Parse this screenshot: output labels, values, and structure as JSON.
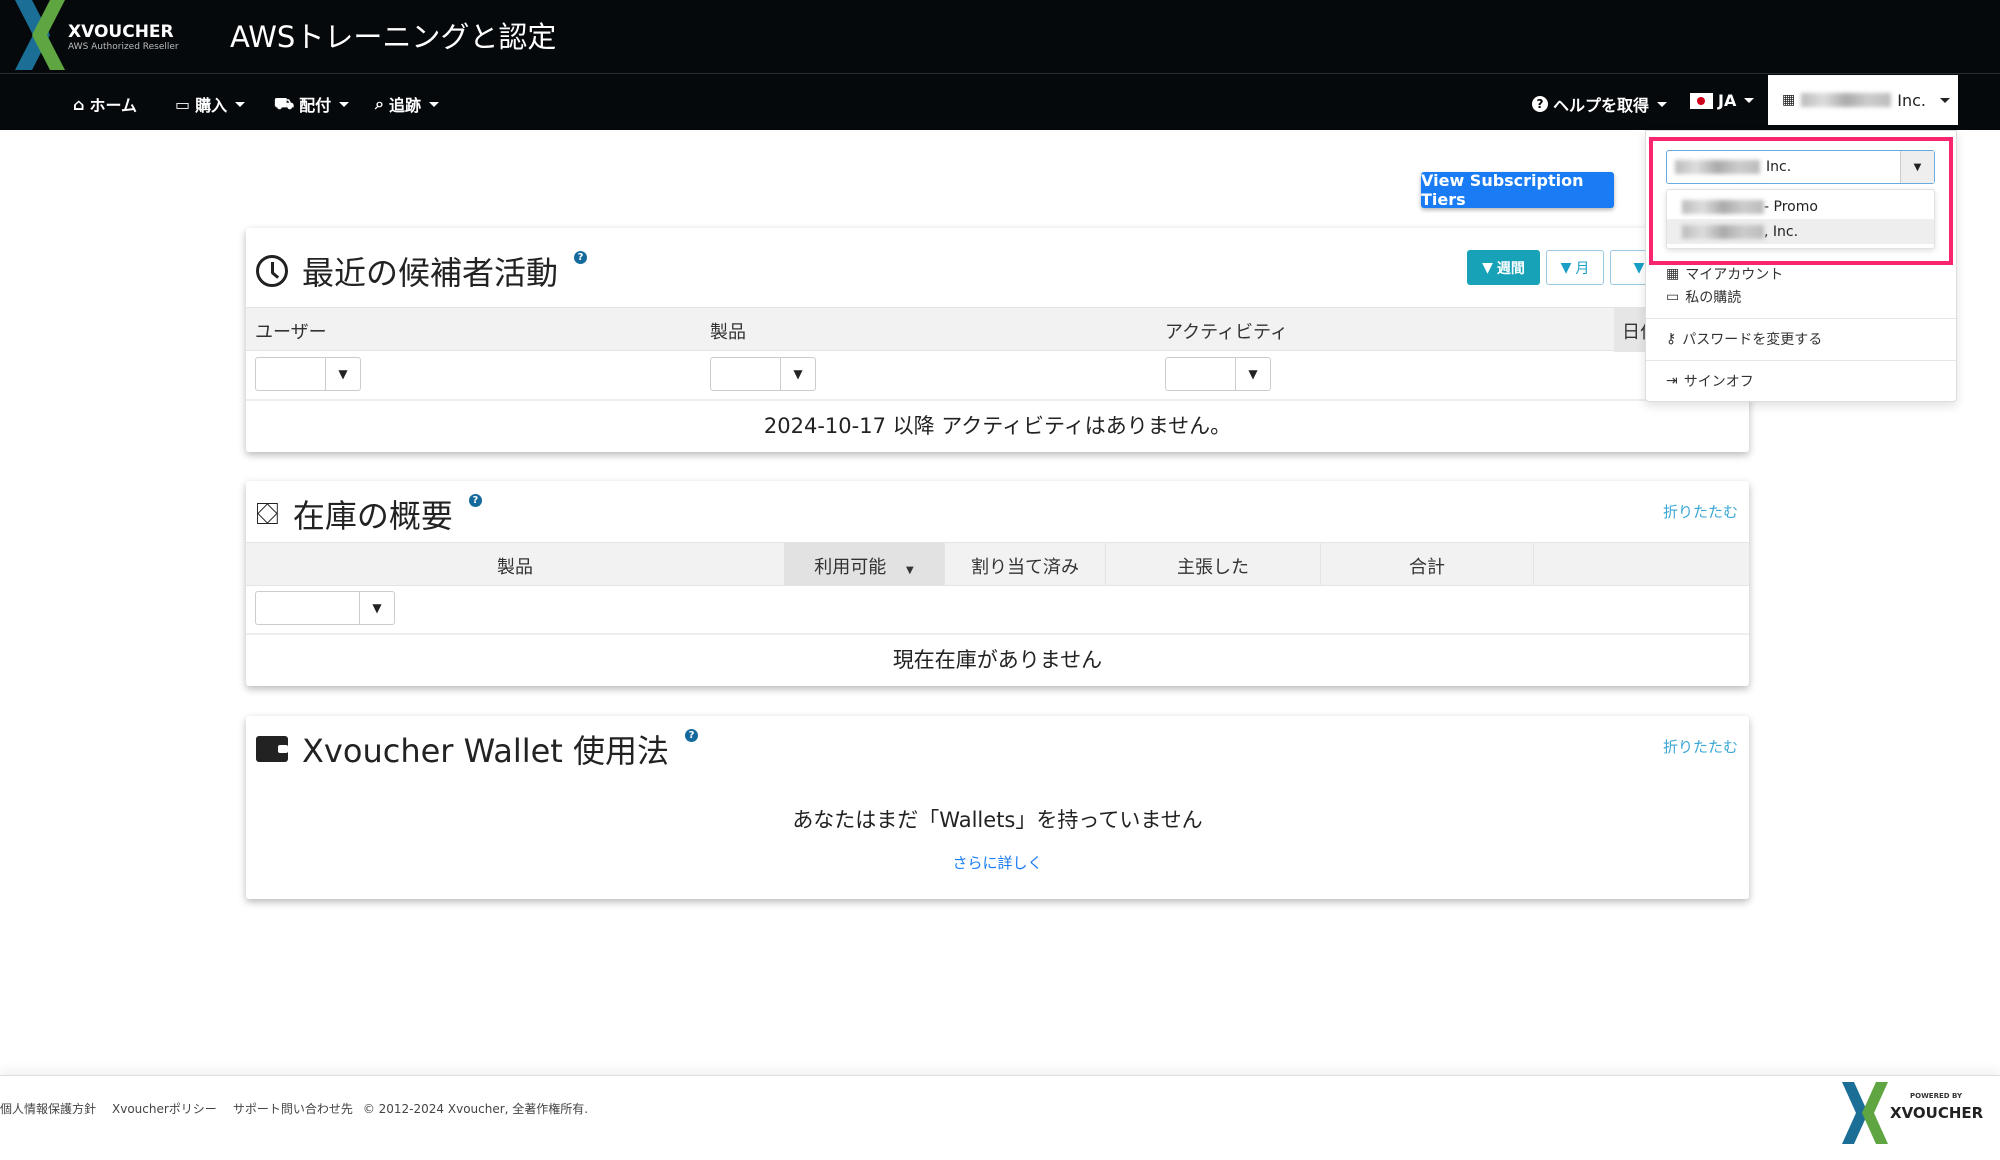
{
  "header": {
    "logo": {
      "brand": "XVOUCHER",
      "tagline": "AWS Authorized Reseller"
    },
    "title": "AWSトレーニングと認定"
  },
  "nav": {
    "items": [
      {
        "label": "ホーム",
        "icon": "home-icon"
      },
      {
        "label": "購入",
        "icon": "credit-card-icon"
      },
      {
        "label": "配付",
        "icon": "truck-icon"
      },
      {
        "label": "追跡",
        "icon": "search-icon"
      }
    ],
    "help": "ヘルプを取得",
    "language": "JA",
    "account_suffix": "Inc."
  },
  "account_menu": {
    "select_value_suffix": "Inc.",
    "options": [
      {
        "suffix": " - Promo",
        "selected": false
      },
      {
        "suffix": ", Inc.",
        "selected": true
      }
    ],
    "items": [
      "マイアカウント",
      "私の購読",
      "パスワードを変更する",
      "サインオフ"
    ],
    "highlight_color": "#f7266e"
  },
  "view_tiers_button": "View Subscription Tiers",
  "activity": {
    "title": "最近の候補者活動",
    "filters": [
      "週間",
      "月"
    ],
    "columns": [
      "ユーザー",
      "製品",
      "アクティビティ",
      "日付"
    ],
    "empty": "2024-10-17 以降 アクティビティはありません。"
  },
  "inventory": {
    "title": "在庫の概要",
    "collapse": "折りたたむ",
    "columns": [
      "製品",
      "利用可能",
      "割り当て済み",
      "主張した",
      "合計"
    ],
    "empty": "現在在庫がありません"
  },
  "wallet": {
    "title": "Xvoucher Wallet 使用法",
    "collapse": "折りたたむ",
    "empty": "あなたはまだ「Wallets」を持っていません",
    "learn_more": "さらに詳しく"
  },
  "footer": {
    "links": [
      "個人情報保護方針",
      "Xvoucherポリシー",
      "サポート問い合わせ先"
    ],
    "copyright": "© 2012-2024 Xvoucher, 全著作権所有.",
    "powered_by": "POWERED BY",
    "brand": "XVOUCHER"
  },
  "colors": {
    "primary": "#1a7cf4",
    "info": "#17a2b8",
    "link": "#3ba7d6",
    "nav_bg": "#05090c"
  }
}
